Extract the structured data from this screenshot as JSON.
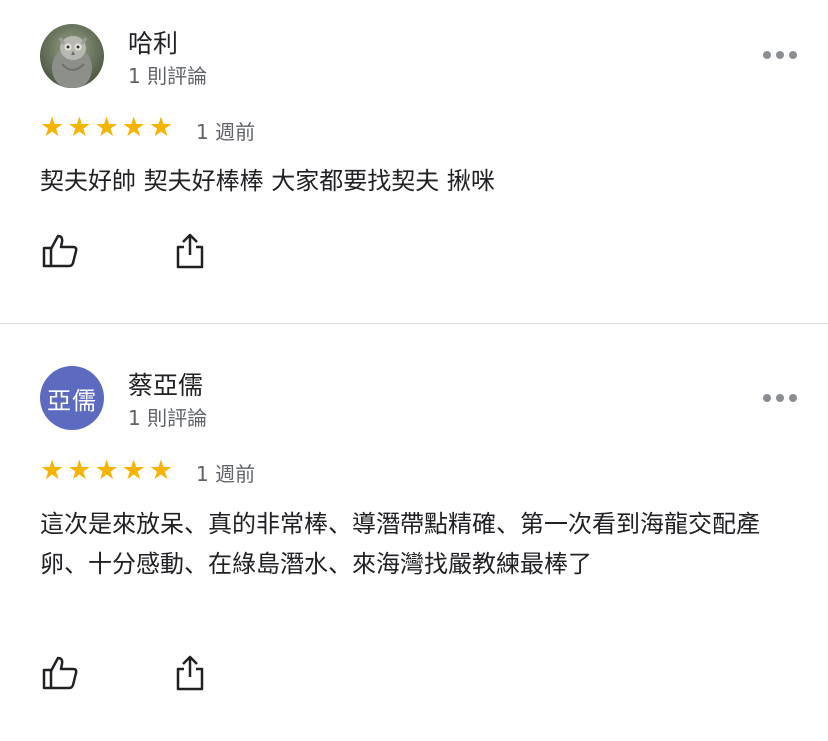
{
  "reviews": [
    {
      "author": "哈利",
      "review_count": "1 則評論",
      "avatar": {
        "type": "photo",
        "icon": "owl-statue-photo",
        "bg": "#6b7a5e"
      },
      "rating": 5,
      "stars": [
        "★",
        "★",
        "★",
        "★",
        "★"
      ],
      "time": "1 週前",
      "text": "契夫好帥 契夫好棒棒 大家都要找契夫 揪咪",
      "actions": {
        "like_icon": "thumbs-up-icon",
        "share_icon": "share-icon"
      }
    },
    {
      "author": "蔡亞儒",
      "review_count": "1 則評論",
      "avatar": {
        "type": "initials",
        "initials": "亞儒",
        "bg": "#5c6bc0"
      },
      "rating": 5,
      "stars": [
        "★",
        "★",
        "★",
        "★",
        "★"
      ],
      "time": "1 週前",
      "text": "這次是來放呆、真的非常棒、導潛帶點精確、第一次看到海龍交配產卵、十分感動、在綠島潛水、來海灣找嚴教練最棒了",
      "actions": {
        "like_icon": "thumbs-up-icon",
        "share_icon": "share-icon"
      }
    }
  ],
  "colors": {
    "star": "#f5b400",
    "secondary_text": "#5f6368",
    "divider": "#dadce0"
  }
}
